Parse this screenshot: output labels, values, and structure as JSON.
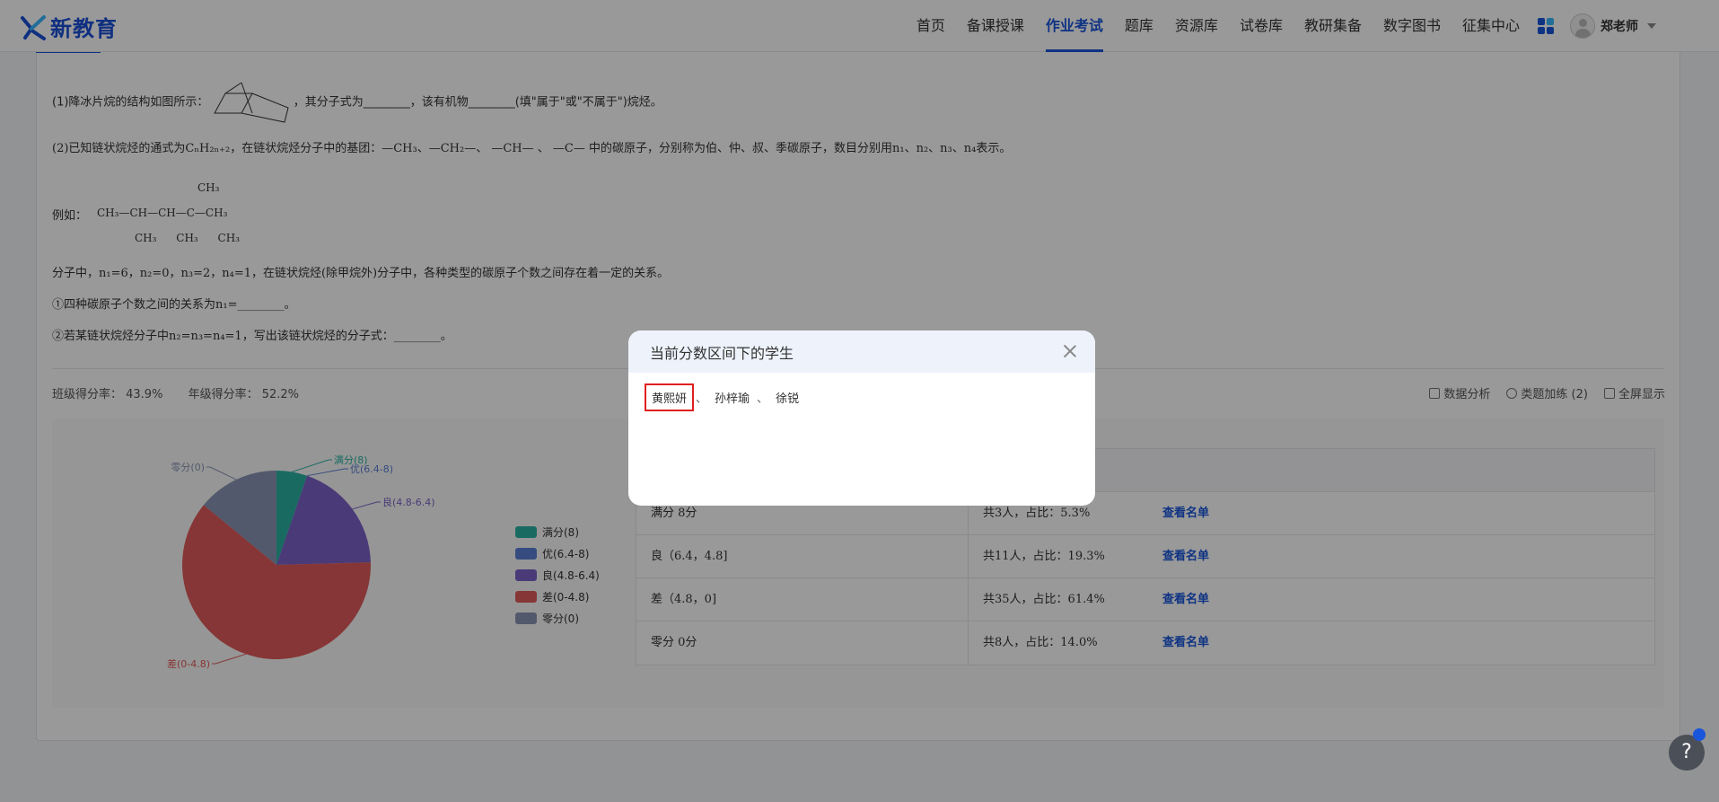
{
  "brand": {
    "name": "新教育"
  },
  "nav": {
    "items": [
      "首页",
      "备课授课",
      "作业考试",
      "题库",
      "资源库",
      "试卷库",
      "教研集备",
      "数字图书",
      "征集中心"
    ],
    "active_index": 2,
    "user_name": "郑老师"
  },
  "question": {
    "line1_a": "(1)降冰片烷的结构如图所示：",
    "line1_b": "，其分子式为________，该有机物________(填\"属于\"或\"不属于\")烷烃。",
    "line2": "(2)已知链状烷烃的通式为CₙH₂ₙ₊₂，在链状烷烃分子中的基团：—CH₃、—CH₂—、 —CH— 、 —C— 中的碳原子，分别称为伯、仲、叔、季碳原子，数目分别用n₁、n₂、n₃、n₄表示。",
    "example_label": "例如：",
    "formula_top": "CH₃",
    "formula_main": "CH₃—CH—CH—C—CH₃",
    "formula_bottom": "CH₃ CH₃ CH₃",
    "line3": "分子中，n₁=6，n₂=0，n₃=2，n₄=1，在链状烷烃(除甲烷外)分子中，各种类型的碳原子个数之间存在着一定的关系。",
    "line4": "①四种碳原子个数之间的关系为n₁=________。",
    "line5": "②若某链状烷烃分子中n₂=n₃=n₄=1，写出该链状烷烃的分子式：________。"
  },
  "stats": {
    "class_rate": "班级得分率： 43.9%",
    "grade_rate": "年级得分率： 52.2%"
  },
  "tools": {
    "analysis": "数据分析",
    "practice": "类题加练 (2)",
    "fullscreen": "全屏显示"
  },
  "chart_data": {
    "type": "pie",
    "labels": [
      "满分(8)",
      "优(6.4-8)",
      "良(4.8-6.4)",
      "差(0-4.8)",
      "零分(0)"
    ],
    "values": [
      3,
      0,
      11,
      35,
      8
    ],
    "colors": [
      "#2bb3a3",
      "#5b7fd6",
      "#7c62c8",
      "#e05b5b",
      "#8a95b4"
    ]
  },
  "table": {
    "rows": [
      {
        "range": "满分 8分",
        "count": "共3人，占比：5.3%",
        "action": "查看名单"
      },
      {
        "range": "良（6.4，4.8]",
        "count": "共11人，占比：19.3%",
        "action": "查看名单"
      },
      {
        "range": "差（4.8，0]",
        "count": "共35人，占比：61.4%",
        "action": "查看名单"
      },
      {
        "range": "零分 0分",
        "count": "共8人，占比：14.0%",
        "action": "查看名单"
      }
    ]
  },
  "modal": {
    "title": "当前分数区间下的学生",
    "students": [
      "黄熙妍",
      "孙梓瑜",
      "徐锐"
    ],
    "separator": "、"
  },
  "help": {
    "label": "?"
  }
}
